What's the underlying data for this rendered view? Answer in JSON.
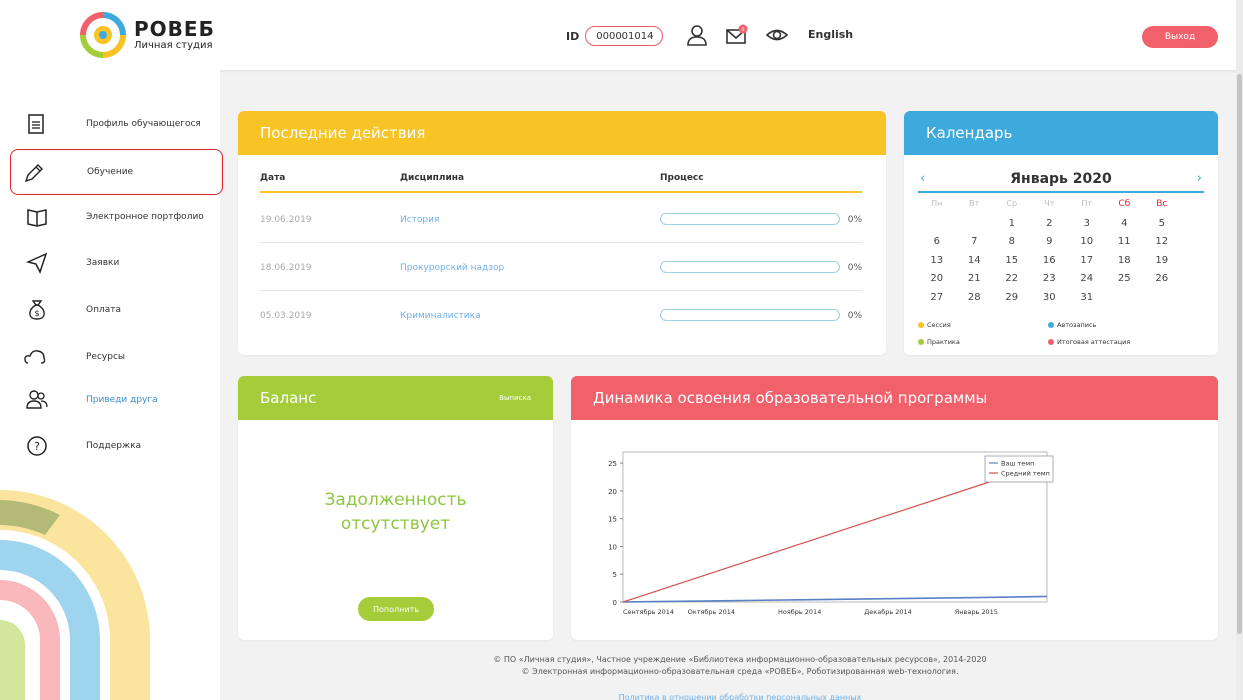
{
  "header": {
    "logo_title": "РОВЕБ",
    "logo_sub": "Личная студия",
    "id_label": "ID",
    "id_value": "000001014",
    "mail_badge": "0",
    "language": "English",
    "logout": "Выход"
  },
  "sidebar": {
    "items": [
      {
        "label": "Профиль обучающегося",
        "icon": "document-icon"
      },
      {
        "label": "Обучение",
        "icon": "pen-icon"
      },
      {
        "label": "Электронное портфолио",
        "icon": "book-icon"
      },
      {
        "label": "Заявки",
        "icon": "send-icon"
      },
      {
        "label": "Оплата",
        "icon": "money-bag-icon"
      },
      {
        "label": "Ресурсы",
        "icon": "cloud-icon"
      },
      {
        "label": "Приведи друга",
        "icon": "users-icon"
      },
      {
        "label": "Поддержка",
        "icon": "help-icon"
      }
    ]
  },
  "activity": {
    "title": "Последние действия",
    "columns": [
      "Дата",
      "Дисциплина",
      "Процесс"
    ],
    "rows": [
      {
        "date": "19.06.2019",
        "discipline": "История",
        "progress": 0,
        "pct": "0%"
      },
      {
        "date": "18.06.2019",
        "discipline": "Прокурорский надзор",
        "progress": 0,
        "pct": "0%"
      },
      {
        "date": "05.03.2019",
        "discipline": "Криминалистика",
        "progress": 0,
        "pct": "0%"
      }
    ]
  },
  "calendar": {
    "title": "Календарь",
    "month": "Январь 2020",
    "prev": "‹",
    "next": "›",
    "day_names": [
      "Пн",
      "Вт",
      "Ср",
      "Чт",
      "Пт",
      "Сб",
      "Вс"
    ],
    "weeks": [
      [
        "",
        "",
        "1",
        "2",
        "3",
        "4",
        "5"
      ],
      [
        "6",
        "7",
        "8",
        "9",
        "10",
        "11",
        "12"
      ],
      [
        "13",
        "14",
        "15",
        "16",
        "17",
        "18",
        "19"
      ],
      [
        "20",
        "21",
        "22",
        "23",
        "24",
        "25",
        "26"
      ],
      [
        "27",
        "28",
        "29",
        "30",
        "31",
        "",
        ""
      ]
    ],
    "legend": [
      {
        "label": "Сессия",
        "color": "#f7c325"
      },
      {
        "label": "Автозапись",
        "color": "#3ea9dc"
      },
      {
        "label": "Практика",
        "color": "#a5cd39"
      },
      {
        "label": "Итоговая аттестация",
        "color": "#f0616b"
      }
    ]
  },
  "balance": {
    "title": "Баланс",
    "statement": "Выписка",
    "message_line1": "Задолженность",
    "message_line2": "отсутствует",
    "topup": "Пополнить"
  },
  "dynamics": {
    "title": "Динамика освоения образовательной программы"
  },
  "chart_data": {
    "type": "line",
    "x": [
      "Сентябрь 2014",
      "Октябрь 2014",
      "Ноябрь 2014",
      "Декабрь 2014",
      "Январь 2015"
    ],
    "ylim": [
      0,
      27
    ],
    "yticks": [
      0,
      5,
      10,
      15,
      20,
      25
    ],
    "legend_position": "top-right",
    "series": [
      {
        "name": "Ваш темп",
        "color": "#5b7fc4",
        "points": [
          [
            0,
            0
          ],
          [
            1,
            0.2
          ],
          [
            2,
            0.4
          ],
          [
            3,
            0.6
          ],
          [
            4,
            0.8
          ],
          [
            4.8,
            1
          ]
        ]
      },
      {
        "name": "Средний темп",
        "color": "#d85050",
        "points": [
          [
            0,
            0
          ],
          [
            4.8,
            25
          ]
        ]
      }
    ]
  },
  "footer": {
    "line1": "© ПО «Личная студия», Частное учреждение «Библиотека информационно-образовательных ресурсов», 2014-2020",
    "line2": "© Электронная информационно-образовательная среда «РОВЕБ», Роботизированная web-технология.",
    "link": "Политика в отношении обработки персональных данных"
  },
  "colors": {
    "accent_red": "#e0242f",
    "yellow": "#f7c325",
    "blue": "#3ea9dc",
    "green": "#a5cd39",
    "pink": "#f0616b"
  }
}
